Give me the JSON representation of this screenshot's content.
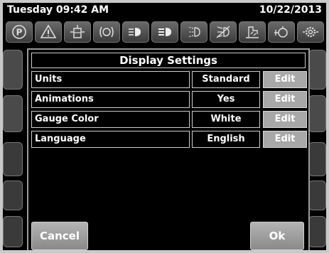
{
  "status": {
    "time": "Tuesday 09:42 AM",
    "date": "10/22/2013"
  },
  "toolbar": {
    "icons": [
      "parking-icon",
      "warning-triangle-icon",
      "fuel-filter-icon",
      "brake-icon",
      "headlight-icon",
      "highbeam-icon",
      "fog-light-icon",
      "fog-light-off-icon",
      "wiper-icon",
      "engine-icon",
      "gear-icon"
    ]
  },
  "dialog": {
    "title": "Display Settings",
    "rows": [
      {
        "label": "Units",
        "value": "Standard",
        "action": "Edit"
      },
      {
        "label": "Animations",
        "value": "Yes",
        "action": "Edit"
      },
      {
        "label": "Gauge Color",
        "value": "White",
        "action": "Edit"
      },
      {
        "label": "Language",
        "value": "English",
        "action": "Edit"
      }
    ],
    "cancel": "Cancel",
    "ok": "Ok"
  },
  "colors": {
    "screen_bg": "#000000",
    "edit_button": "#a8a8a8",
    "border": "#cfcfcf"
  }
}
